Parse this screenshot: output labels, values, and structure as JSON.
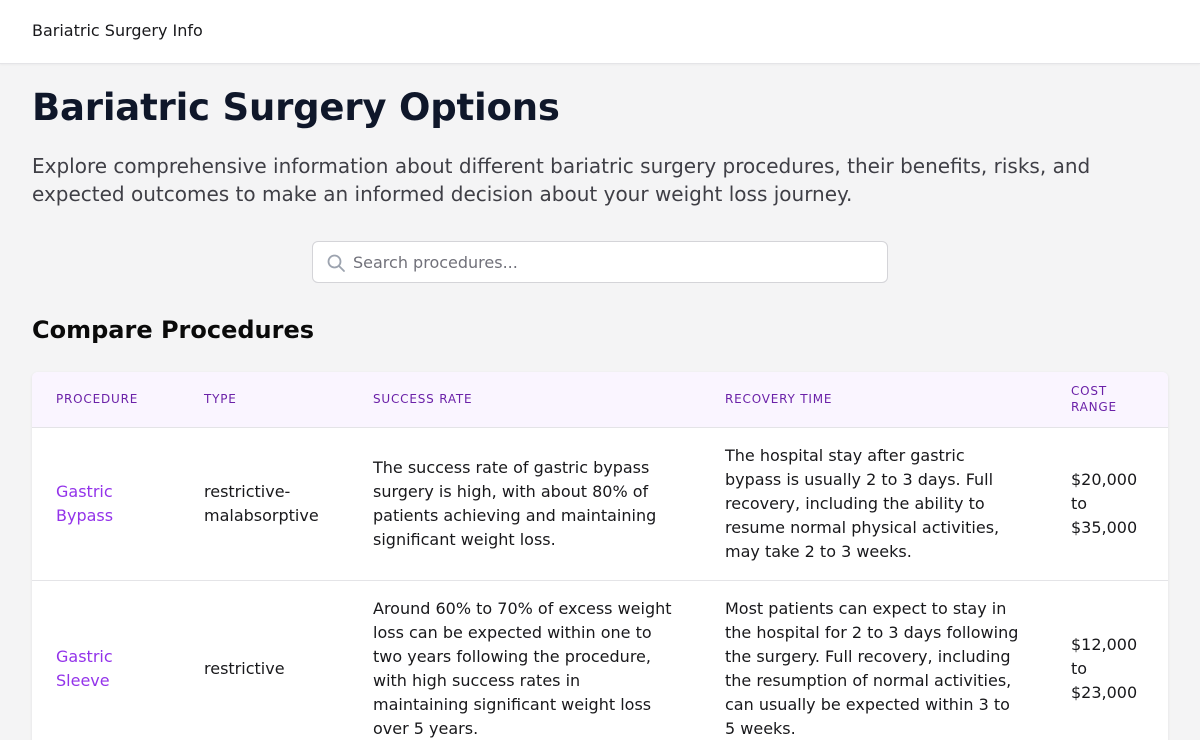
{
  "header": {
    "brand": "Bariatric Surgery Info"
  },
  "main": {
    "title": "Bariatric Surgery Options",
    "intro": "Explore comprehensive information about different bariatric surgery procedures, their benefits, risks, and expected outcomes to make an informed decision about your weight loss journey.",
    "search": {
      "placeholder": "Search procedures...",
      "value": "",
      "icon": "search-icon"
    },
    "compare_title": "Compare Procedures"
  },
  "table": {
    "columns": [
      "Procedure",
      "Type",
      "Success Rate",
      "Recovery Time",
      "Cost Range"
    ],
    "rows": [
      {
        "procedure": "Gastric Bypass",
        "type": "restrictive-malabsorptive",
        "success_rate": "The success rate of gastric bypass surgery is high, with about 80% of patients achieving and maintaining significant weight loss.",
        "recovery_time": "The hospital stay after gastric bypass is usually 2 to 3 days. Full recovery, including the ability to resume normal physical activities, may take 2 to 3 weeks.",
        "cost_range": "$20,000 to $35,000"
      },
      {
        "procedure": "Gastric Sleeve",
        "type": "restrictive",
        "success_rate": "Around 60% to 70% of excess weight loss can be expected within one to two years following the procedure, with high success rates in maintaining significant weight loss over 5 years.",
        "recovery_time": "Most patients can expect to stay in the hospital for 2 to 3 days following the surgery. Full recovery, including the resumption of normal activities, can usually be expected within 3 to 5 weeks.",
        "cost_range": "$12,000 to $23,000"
      }
    ]
  },
  "colors": {
    "accent": "#9333ea",
    "header_bg": "#faf5ff",
    "header_text": "#6b21a8",
    "page_bg": "#f4f4f5"
  }
}
